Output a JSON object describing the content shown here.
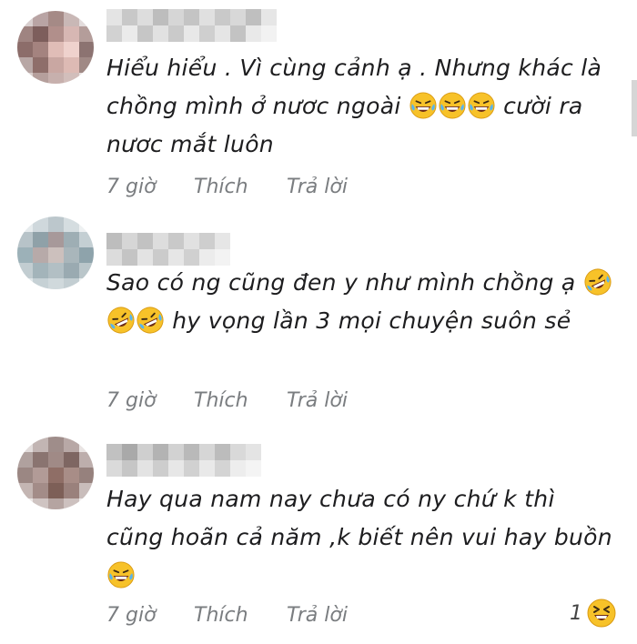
{
  "comments": [
    {
      "text_parts": [
        "Hiểu hiểu . Vì cùng cảnh ạ . Nhưng khác là chồng mình ở nươc ngoài ",
        " cười ra nươc mắt luôn"
      ],
      "emoji_count": 3,
      "time": "7 giờ",
      "like": "Thích",
      "reply": "Trả lời"
    },
    {
      "text_parts": [
        "Sao có ng cũng đen y như mình chồng ạ ",
        " hy vọng lần 3 mọi chuyện suôn sẻ"
      ],
      "emoji_count": 3,
      "time": "7 giờ",
      "like": "Thích",
      "reply": "Trả lời"
    },
    {
      "text_parts": [
        "Hay qua nam nay chưa có ny chứ k thì cũng hoãn cả năm ,k biết nên vui hay buồn ",
        ""
      ],
      "emoji_count": 1,
      "time": "7 giờ",
      "like": "Thích",
      "reply": "Trả lời"
    }
  ],
  "reaction": {
    "count": "1",
    "icon": "laughing-emoji-icon"
  },
  "colors": {
    "meta": "#7a7d80",
    "emoji_face": "#f7c229"
  }
}
